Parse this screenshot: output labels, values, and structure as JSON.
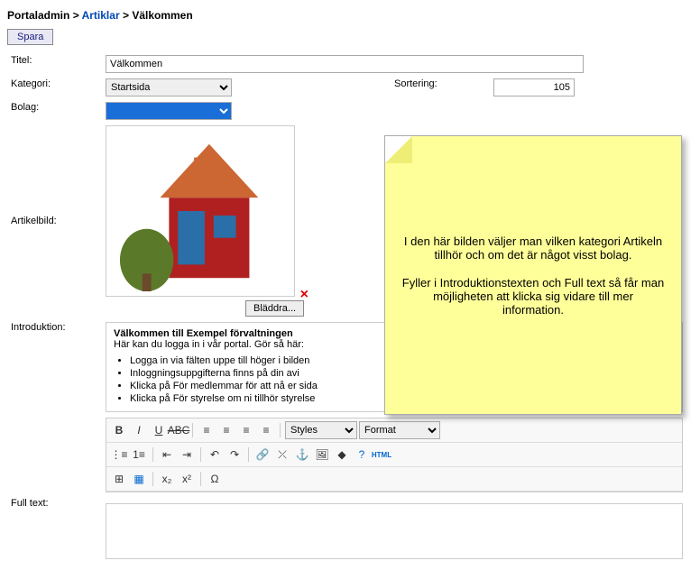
{
  "breadcrumb": {
    "root": "Portaladmin",
    "mid": "Artiklar",
    "leaf": "Välkommen"
  },
  "save_btn": "Spara",
  "labels": {
    "titel": "Titel:",
    "kategori": "Kategori:",
    "sortering": "Sortering:",
    "bolag": "Bolag:",
    "artikelbild": "Artikelbild:",
    "introduktion": "Introduktion:",
    "fulltext": "Full text:"
  },
  "values": {
    "titel": "Välkommen",
    "kategori": "Startsida",
    "sortering": "105",
    "bolag": ""
  },
  "browse_btn": "Bläddra...",
  "intro": {
    "heading": "Välkommen till Exempel förvaltningen",
    "sub": "Här kan du logga in i vår portal. Gör så här:",
    "items": [
      "Logga in via fälten uppe till höger i bilden",
      "Inloggningsuppgifterna finns på din avi",
      "Klicka på För medlemmar för att nå er sida",
      "Klicka på För styrelse om ni tillhör styrelse"
    ]
  },
  "toolbar": {
    "styles": "Styles",
    "format": "Format",
    "html": "HTML"
  },
  "sticky": {
    "p1": "I den här bilden väljer man vilken kategori Artikeln tillhör och om det är något visst bolag.",
    "p2": "Fyller i Introduktionstexten och Full text så får man möjligheten att klicka sig vidare till mer information."
  }
}
